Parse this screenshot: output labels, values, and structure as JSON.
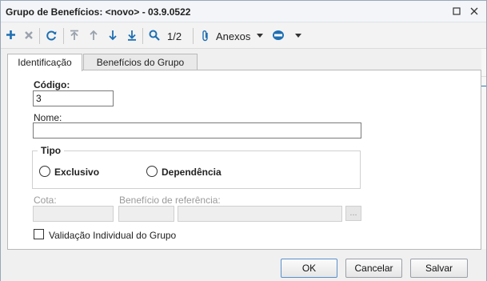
{
  "window": {
    "title": "Grupo de Benefícios: <novo> - 03.9.0522"
  },
  "window_controls": {
    "maximize_icon": "maximize-icon",
    "close_icon": "close-icon"
  },
  "toolbar": {
    "page_indicator": "1/2",
    "attachments_label": "Anexos"
  },
  "tabs": [
    {
      "label": "Identificação",
      "active": true
    },
    {
      "label": "Benefícios do Grupo",
      "active": false
    }
  ],
  "form": {
    "codigo_label": "Código:",
    "codigo_value": "3",
    "nome_label": "Nome:",
    "nome_value": "",
    "tipo_label": "Tipo",
    "tipo_options": [
      "Exclusivo",
      "Dependência"
    ],
    "cota_label": "Cota:",
    "cota_value": "",
    "beneficio_ref_label": "Benefício de referência:",
    "beneficio_ref_code": "",
    "beneficio_ref_name": "",
    "ellipsis_label": "...",
    "validacao_label": "Validação Individual do Grupo",
    "validacao_checked": false
  },
  "buttons": {
    "ok": "OK",
    "cancel": "Cancelar",
    "save": "Salvar"
  },
  "colors": {
    "accent": "#1e6fb3",
    "disabled": "#9aa3ad"
  }
}
